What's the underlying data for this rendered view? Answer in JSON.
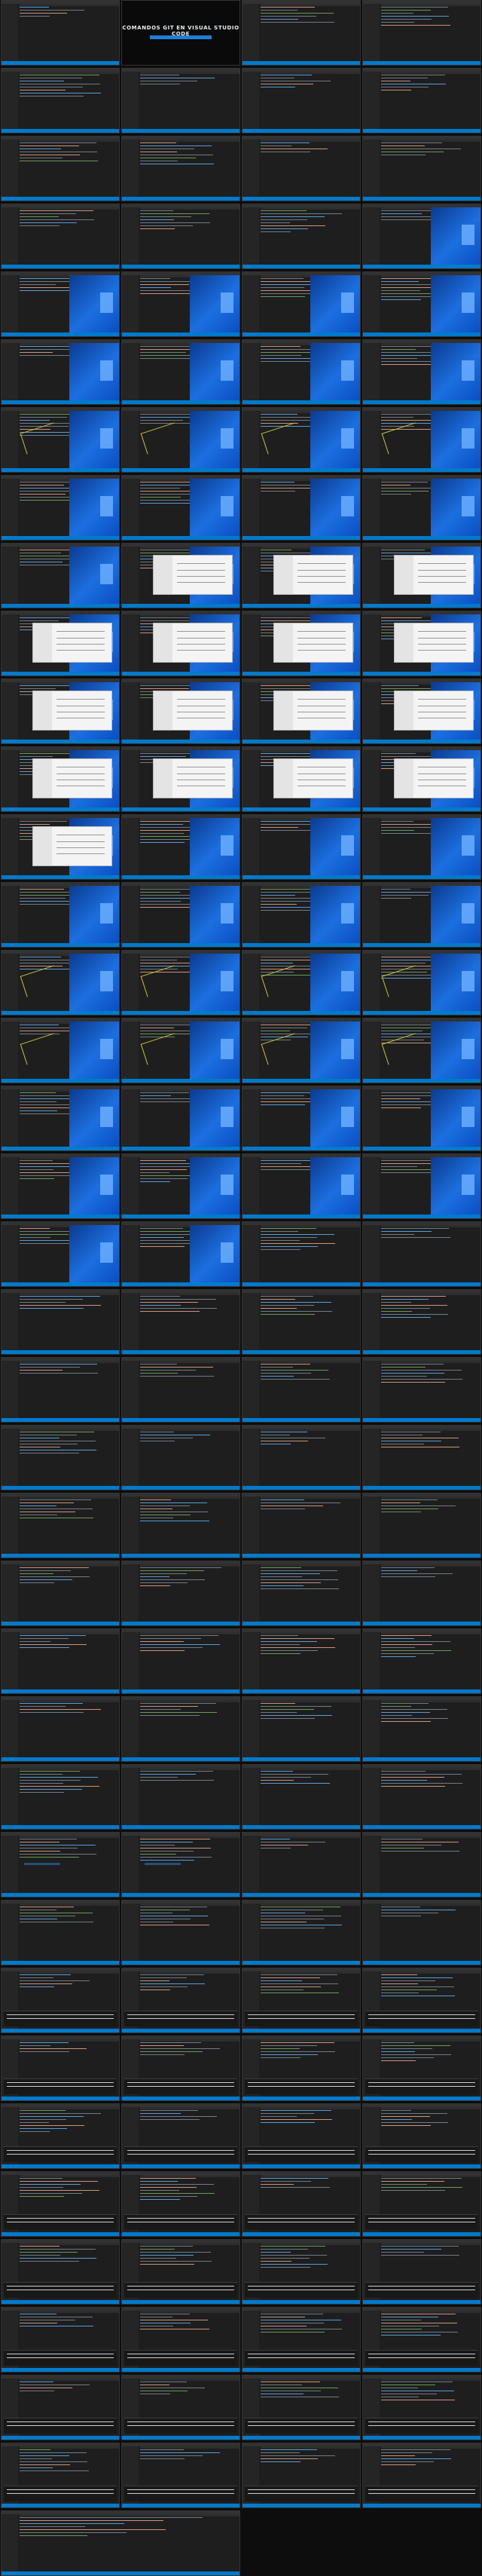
{
  "intro": {
    "title": "COMANDOS GIT EN VISUAL STUDIO CODE",
    "subtitle": ""
  },
  "palette": {
    "editor_bg": "#1e1e1e",
    "sidebar_bg": "#252526",
    "statusbar": "#007acc",
    "keyword": "#569cd6",
    "string": "#ce9178",
    "comment": "#6a9955",
    "desktop_blue": "#1c6fe0",
    "dialog_bg": "#f4f4f4"
  },
  "frames": [
    {
      "variant": "editor"
    },
    {
      "variant": "intro"
    },
    {
      "variant": "editor"
    },
    {
      "variant": "editor"
    },
    {
      "variant": "editor"
    },
    {
      "variant": "editor"
    },
    {
      "variant": "editor"
    },
    {
      "variant": "editor"
    },
    {
      "variant": "editor"
    },
    {
      "variant": "editor"
    },
    {
      "variant": "editor"
    },
    {
      "variant": "editor"
    },
    {
      "variant": "editor"
    },
    {
      "variant": "editor"
    },
    {
      "variant": "editor"
    },
    {
      "variant": "desktop"
    },
    {
      "variant": "desktop"
    },
    {
      "variant": "desktop"
    },
    {
      "variant": "desktop"
    },
    {
      "variant": "desktop"
    },
    {
      "variant": "desktop"
    },
    {
      "variant": "desktop"
    },
    {
      "variant": "desktop"
    },
    {
      "variant": "desktop"
    },
    {
      "variant": "desktop-scribble"
    },
    {
      "variant": "desktop-scribble"
    },
    {
      "variant": "desktop-scribble"
    },
    {
      "variant": "desktop-scribble"
    },
    {
      "variant": "desktop"
    },
    {
      "variant": "desktop"
    },
    {
      "variant": "desktop"
    },
    {
      "variant": "desktop"
    },
    {
      "variant": "desktop"
    },
    {
      "variant": "dialog"
    },
    {
      "variant": "dialog"
    },
    {
      "variant": "dialog"
    },
    {
      "variant": "dialog"
    },
    {
      "variant": "dialog"
    },
    {
      "variant": "dialog"
    },
    {
      "variant": "dialog"
    },
    {
      "variant": "dialog"
    },
    {
      "variant": "dialog"
    },
    {
      "variant": "dialog"
    },
    {
      "variant": "dialog"
    },
    {
      "variant": "dialog"
    },
    {
      "variant": "dialog"
    },
    {
      "variant": "dialog"
    },
    {
      "variant": "dialog"
    },
    {
      "variant": "dialog"
    },
    {
      "variant": "desktop"
    },
    {
      "variant": "desktop"
    },
    {
      "variant": "desktop"
    },
    {
      "variant": "desktop"
    },
    {
      "variant": "desktop"
    },
    {
      "variant": "desktop"
    },
    {
      "variant": "desktop"
    },
    {
      "variant": "desktop-scribble"
    },
    {
      "variant": "desktop-scribble"
    },
    {
      "variant": "desktop-scribble"
    },
    {
      "variant": "desktop-scribble"
    },
    {
      "variant": "desktop-scribble"
    },
    {
      "variant": "desktop-scribble"
    },
    {
      "variant": "desktop-scribble"
    },
    {
      "variant": "desktop-scribble"
    },
    {
      "variant": "desktop"
    },
    {
      "variant": "desktop"
    },
    {
      "variant": "desktop"
    },
    {
      "variant": "desktop"
    },
    {
      "variant": "desktop"
    },
    {
      "variant": "desktop"
    },
    {
      "variant": "desktop"
    },
    {
      "variant": "desktop"
    },
    {
      "variant": "desktop"
    },
    {
      "variant": "desktop"
    },
    {
      "variant": "editor"
    },
    {
      "variant": "editor"
    },
    {
      "variant": "editor"
    },
    {
      "variant": "editor"
    },
    {
      "variant": "editor"
    },
    {
      "variant": "editor"
    },
    {
      "variant": "editor"
    },
    {
      "variant": "editor"
    },
    {
      "variant": "editor"
    },
    {
      "variant": "editor"
    },
    {
      "variant": "editor"
    },
    {
      "variant": "editor"
    },
    {
      "variant": "editor"
    },
    {
      "variant": "editor"
    },
    {
      "variant": "editor"
    },
    {
      "variant": "editor"
    },
    {
      "variant": "editor"
    },
    {
      "variant": "editor"
    },
    {
      "variant": "editor"
    },
    {
      "variant": "editor"
    },
    {
      "variant": "editor"
    },
    {
      "variant": "editor"
    },
    {
      "variant": "editor"
    },
    {
      "variant": "editor"
    },
    {
      "variant": "editor"
    },
    {
      "variant": "editor"
    },
    {
      "variant": "editor"
    },
    {
      "variant": "editor"
    },
    {
      "variant": "editor"
    },
    {
      "variant": "editor"
    },
    {
      "variant": "editor"
    },
    {
      "variant": "editor"
    },
    {
      "variant": "editor"
    },
    {
      "variant": "editor"
    },
    {
      "variant": "editor-highlight"
    },
    {
      "variant": "editor-highlight"
    },
    {
      "variant": "editor"
    },
    {
      "variant": "editor"
    },
    {
      "variant": "editor"
    },
    {
      "variant": "editor"
    },
    {
      "variant": "editor"
    },
    {
      "variant": "editor"
    },
    {
      "variant": "editor-panel"
    },
    {
      "variant": "editor-panel"
    },
    {
      "variant": "editor-panel"
    },
    {
      "variant": "editor-panel"
    },
    {
      "variant": "editor-panel"
    },
    {
      "variant": "editor-panel"
    },
    {
      "variant": "editor-panel"
    },
    {
      "variant": "editor-panel"
    },
    {
      "variant": "editor-panel"
    },
    {
      "variant": "editor-panel"
    },
    {
      "variant": "editor-panel"
    },
    {
      "variant": "editor-panel"
    },
    {
      "variant": "editor-panel"
    },
    {
      "variant": "editor-panel"
    },
    {
      "variant": "editor-panel"
    },
    {
      "variant": "editor-panel"
    },
    {
      "variant": "editor-panel"
    },
    {
      "variant": "editor-panel"
    },
    {
      "variant": "editor-panel"
    },
    {
      "variant": "editor-panel"
    },
    {
      "variant": "editor-panel"
    },
    {
      "variant": "editor-panel"
    },
    {
      "variant": "editor-panel"
    },
    {
      "variant": "editor-panel"
    },
    {
      "variant": "editor-panel"
    },
    {
      "variant": "editor-panel"
    },
    {
      "variant": "editor-panel"
    },
    {
      "variant": "editor-panel"
    },
    {
      "variant": "editor-panel"
    },
    {
      "variant": "editor-panel"
    },
    {
      "variant": "editor-panel"
    },
    {
      "variant": "editor-panel"
    },
    {
      "variant": "editor-wide"
    }
  ]
}
